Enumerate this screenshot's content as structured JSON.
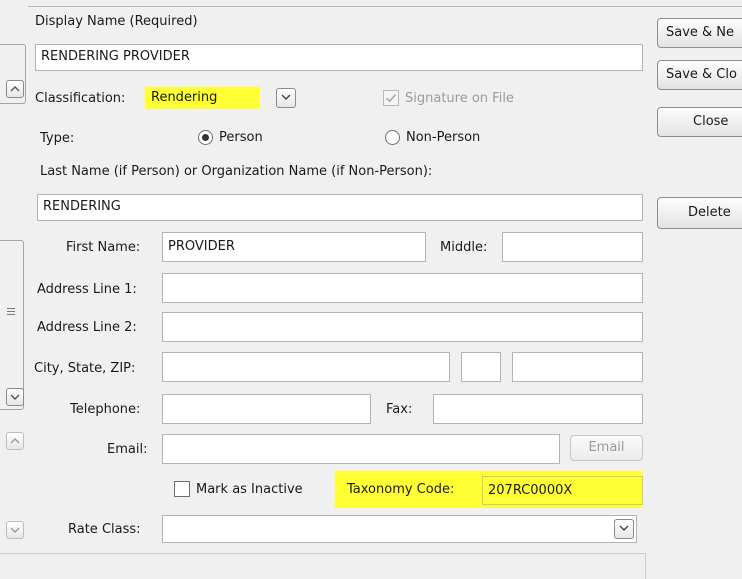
{
  "form": {
    "display_name_label": "Display Name (Required)",
    "display_name_value": "RENDERING PROVIDER",
    "classification_label": "Classification:",
    "classification_value": "Rendering",
    "signature_label": "Signature on File",
    "type_label": "Type:",
    "type_person": "Person",
    "type_nonperson": "Non-Person",
    "type_selected": "Person",
    "last_name_label": "Last Name (if Person) or Organization Name (if Non-Person):",
    "last_name_value": "RENDERING",
    "first_name_label": "First Name:",
    "first_name_value": "PROVIDER",
    "middle_label": "Middle:",
    "middle_value": "",
    "address1_label": "Address Line 1:",
    "address1_value": "",
    "address2_label": "Address Line 2:",
    "address2_value": "",
    "city_state_zip_label": "City, State, ZIP:",
    "city_value": "",
    "state_value": "",
    "zip_value": "",
    "telephone_label": "Telephone:",
    "telephone_value": "",
    "fax_label": "Fax:",
    "fax_value": "",
    "email_label": "Email:",
    "email_value": "",
    "email_button": "Email",
    "inactive_label": "Mark as Inactive",
    "taxonomy_label": "Taxonomy Code:",
    "taxonomy_value": "207RC0000X",
    "rate_class_label": "Rate Class:",
    "rate_class_value": ""
  },
  "buttons": {
    "save_new": "Save & Ne",
    "save_close": "Save & Clo",
    "close": "Close",
    "delete": "Delete"
  },
  "colors": {
    "highlight": "#ffff33",
    "window_bg": "#f0f0f0"
  }
}
